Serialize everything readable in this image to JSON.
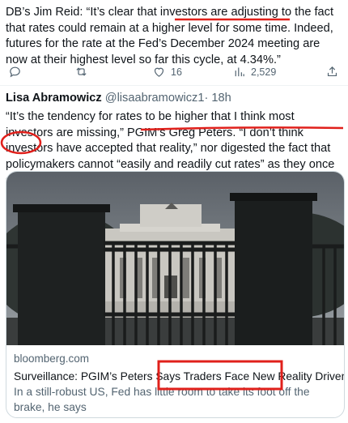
{
  "top_tweet": {
    "text": "DB’s Jim Reid: “It’s clear that investors are adjusting to the fact that rates could remain at a higher level for some time. Indeed, futures for the rate at the Fed’s December 2024 meeting are now at their highest level so far this cycle, at 4.34%.”",
    "actions": {
      "reply_count": "",
      "retweet_count": "",
      "like_count": "16",
      "views_count": "2,529"
    }
  },
  "tweet": {
    "author_name": "Lisa Abramowicz",
    "author_handle": "@lisaabramowicz1",
    "separator": "·",
    "timestamp": "18h",
    "text": "“It’s the tendency for rates to be higher that I think most investors are missing,” PGIM’s Greg Peters. “I don’t think investors have accepted that reality,” nor digested the fact that policymakers cannot “easily and readily cut rates” as they once did."
  },
  "link_card": {
    "domain": "bloomberg.com",
    "title": "Surveillance: PGIM’s Peters Says Traders Face New Reality Driven by ...",
    "description": "In a still-robust US, Fed has little room to take its foot off the brake, he says"
  },
  "colors": {
    "text": "#0f1419",
    "secondary": "#536471",
    "border": "#cfd9de",
    "annotation_red": "#e0201b"
  }
}
